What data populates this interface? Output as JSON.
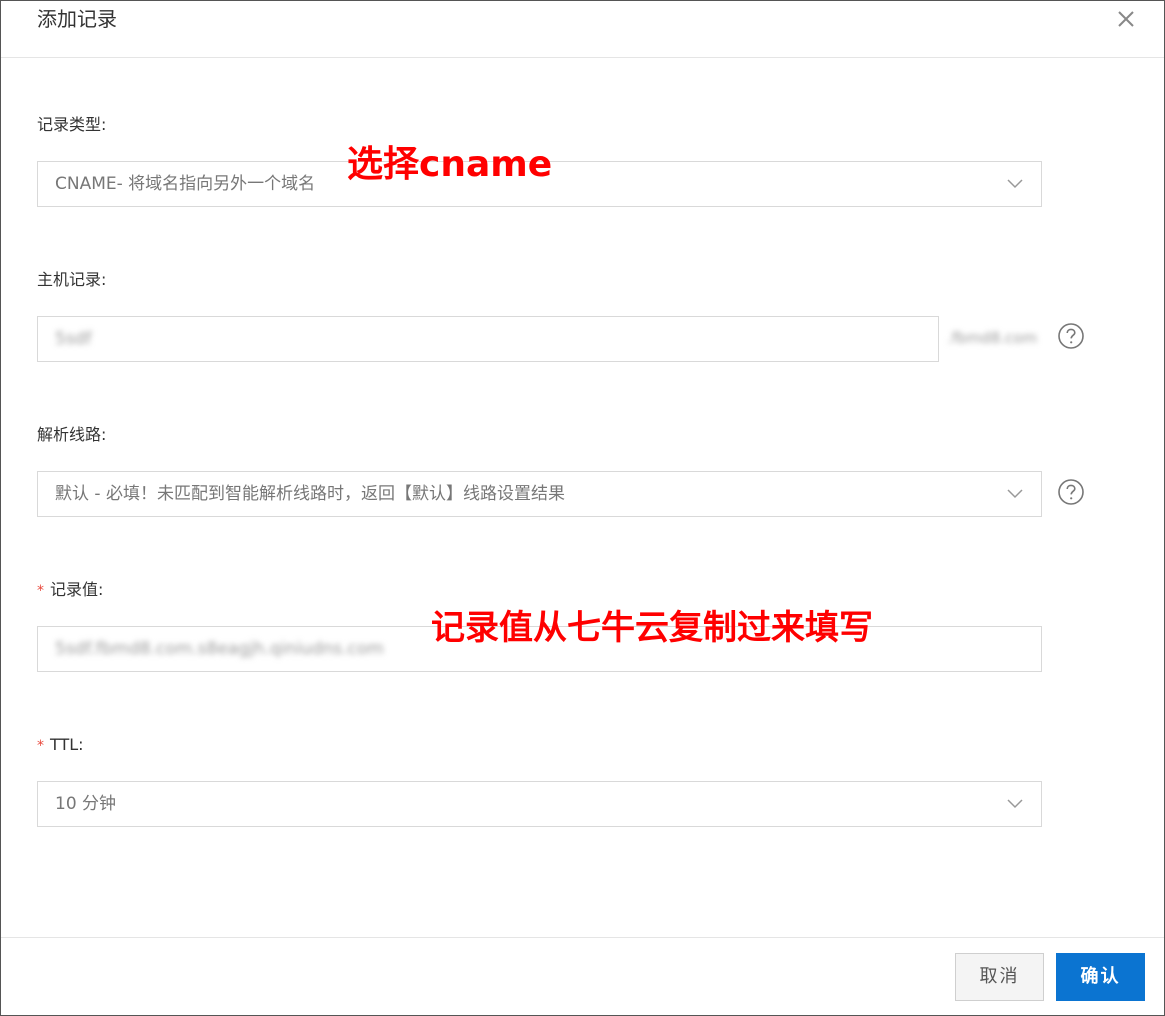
{
  "dialog": {
    "title": "添加记录",
    "close_icon": "close-icon"
  },
  "form": {
    "record_type": {
      "label": "记录类型:",
      "value": "CNAME- 将域名指向另外一个域名"
    },
    "host_record": {
      "label": "主机记录:",
      "value": "5sdf",
      "suffix": ".fbmd8.com"
    },
    "resolution_line": {
      "label": "解析线路:",
      "value": "默认 - 必填！未匹配到智能解析线路时，返回【默认】线路设置结果"
    },
    "record_value": {
      "required": "*",
      "label": "记录值:",
      "value": "5sdf.fbmd8.com.s8eagjh.qiniudns.com"
    },
    "ttl": {
      "required": "*",
      "label": "TTL:",
      "value": "10 分钟"
    }
  },
  "annotations": {
    "select_cname": "选择cname",
    "copy_from_qiniu": "记录值从七牛云复制过来填写"
  },
  "footer": {
    "cancel_label": "取消",
    "confirm_label": "确认"
  },
  "colors": {
    "primary": "#0b74d1",
    "annotation": "#ff0000",
    "required": "#e8483c"
  }
}
